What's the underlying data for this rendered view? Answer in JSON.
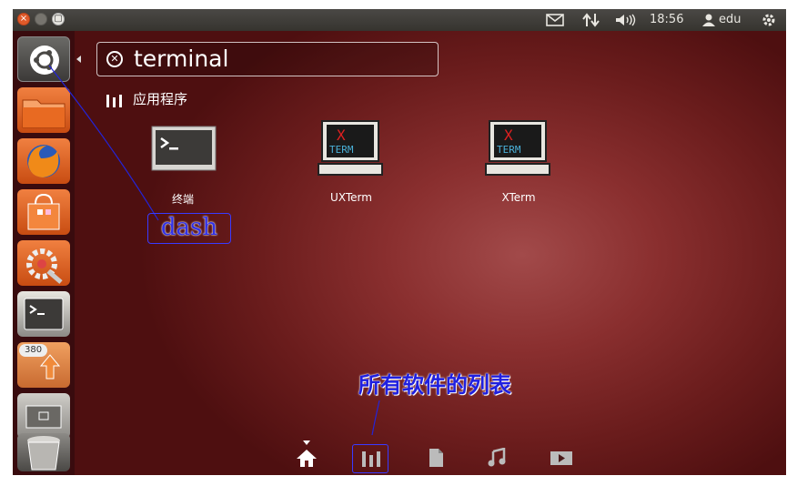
{
  "window": {
    "close_glyph": "×",
    "max_glyph": "▢"
  },
  "tray": {
    "time": "18:56",
    "user": "edu",
    "mail_icon": "mail-icon",
    "network_icon": "network-icon",
    "volume_icon": "volume-icon",
    "user_icon": "user-icon",
    "gear_icon": "gear-icon"
  },
  "launcher": {
    "items": [
      "dash-home",
      "files",
      "firefox",
      "software-center",
      "system-settings",
      "terminal",
      "update-manager",
      "workspace-switcher",
      "trash"
    ],
    "update_badge": "380"
  },
  "search": {
    "query": "terminal"
  },
  "category": {
    "label": "应用程序"
  },
  "results": [
    {
      "label": "终端",
      "icon": "terminal-app-icon"
    },
    {
      "label": "UXTerm",
      "icon": "xterm-app-icon",
      "x_text": "X",
      "term_text": "TERM"
    },
    {
      "label": "XTerm",
      "icon": "xterm-app-icon",
      "x_text": "X",
      "term_text": "TERM"
    }
  ],
  "annotations": {
    "dash": "dash",
    "list": "所有软件的列表"
  },
  "lenses": [
    "home-lens",
    "applications-lens",
    "files-lens",
    "music-lens",
    "video-lens"
  ],
  "colors": {
    "accent": "#e05a2a",
    "annotation": "#2424d8",
    "background": "#7a2424"
  }
}
